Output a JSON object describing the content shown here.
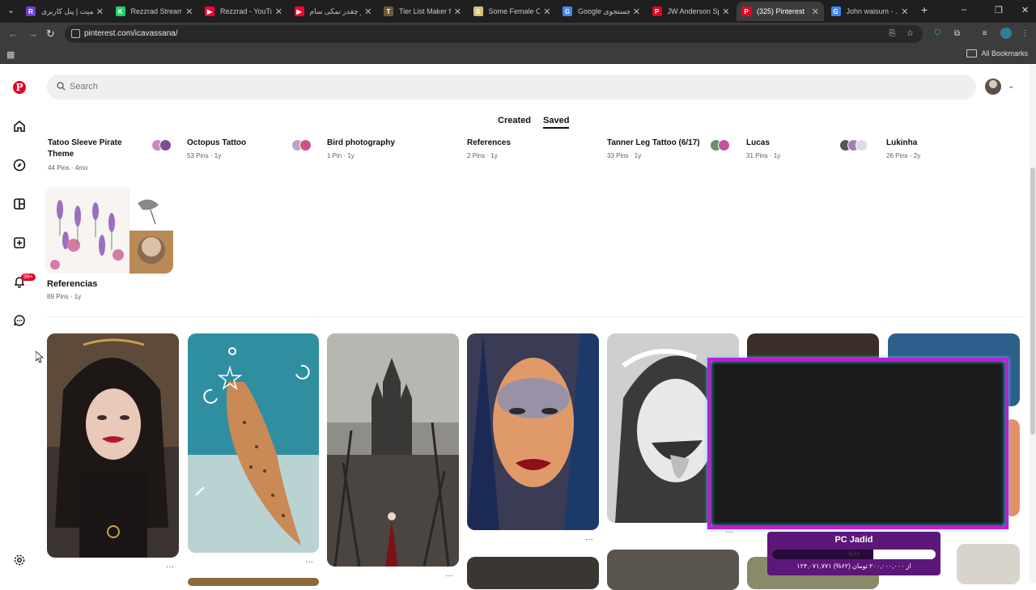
{
  "browser": {
    "tabs": [
      {
        "title": "زیمیت | پنل کاربری",
        "favicon_color": "#6b3fd9",
        "favicon_letter": "R"
      },
      {
        "title": "Rezzrad Stream -",
        "favicon_color": "#1fd16b",
        "favicon_letter": "K"
      },
      {
        "title": "Rezzrad - YouTub",
        "favicon_color": "#ff0033",
        "favicon_letter": "▶"
      },
      {
        "title": "تو چقدر نمکی سام",
        "favicon_color": "#ff0033",
        "favicon_letter": "▶"
      },
      {
        "title": "Tier List Maker fo",
        "favicon_color": "#6b5a3a",
        "favicon_letter": "T"
      },
      {
        "title": "Some Female Cele",
        "favicon_color": "#d4c27a",
        "favicon_letter": "S"
      },
      {
        "title": "Google جستجوی",
        "favicon_color": "#4285f4",
        "favicon_letter": "G"
      },
      {
        "title": "JW Anderson Spri",
        "favicon_color": "#e60023",
        "favicon_letter": "P"
      },
      {
        "title": "(325) Pinterest",
        "favicon_color": "#e60023",
        "favicon_letter": "P",
        "active": true
      },
      {
        "title": "John waisum - ...",
        "favicon_color": "#4285f4",
        "favicon_letter": "G"
      }
    ],
    "url": "pinterest.com/icavassana/",
    "bookmarks_label": "All Bookmarks"
  },
  "search": {
    "placeholder": "Search"
  },
  "profile_tabs": {
    "created": "Created",
    "saved": "Saved"
  },
  "notifications_badge": "99+",
  "boards": [
    {
      "title": "Tatoo Sleeve Pirate Theme",
      "meta": "44 Pins · 4mo"
    },
    {
      "title": "Octopus Tattoo",
      "meta": "53 Pins · 1y"
    },
    {
      "title": "Bird photography",
      "meta": "1 Pin · 1y"
    },
    {
      "title": "References",
      "meta": "2 Pins · 1y"
    },
    {
      "title": "Tanner Leg Tattoo (6/17)",
      "meta": "33 Pins · 1y"
    },
    {
      "title": "Lucas",
      "meta": "31 Pins · 1y"
    },
    {
      "title": "Lukinha",
      "meta": "26 Pins · 2y"
    },
    {
      "title": "Referencias",
      "meta": "89 Pins · 1y"
    }
  ],
  "stream_overlay": {
    "goal_title": "PC Jadid",
    "goal_percent_label": "%۶۲",
    "goal_progress": 0.62,
    "goal_amount": "۱۲۴,۰۷۱,۷۷۱ از ۲۰۰,۰۰۰,۰۰۰ تومان (۶۲%)",
    "frame_color": "#c21bd6",
    "glow_color": "#39e3ff"
  },
  "colors": {
    "pinterest_red": "#e60023"
  },
  "icons": [
    "pinterest-logo-icon",
    "home-icon",
    "explore-icon",
    "boards-icon",
    "create-icon",
    "notifications-icon",
    "messages-icon",
    "settings-icon",
    "search-icon",
    "more-dots-icon"
  ]
}
